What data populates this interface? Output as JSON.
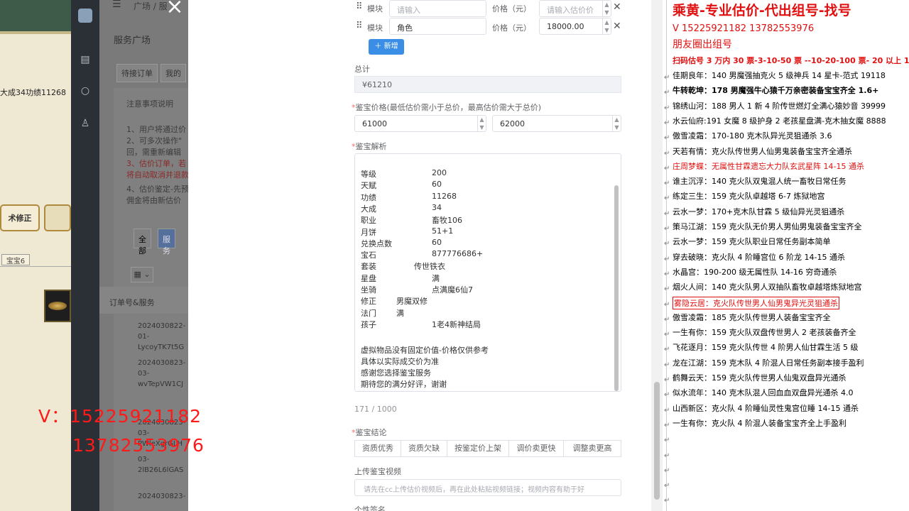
{
  "game": {
    "stat_text": "大成34功绩11268",
    "button_label": "术修正",
    "tab_label": "宝宝6"
  },
  "app": {
    "breadcrumb": "广场 / 服",
    "page_title": "服务广场",
    "tabs": [
      "待接订单",
      "我的"
    ],
    "notes_title": "注意事项说明",
    "notes": [
      {
        "text": "1、用户将通过价",
        "red": false
      },
      {
        "text": "2、可多次操作\"",
        "red": false
      },
      {
        "text": "回，需重新编辑",
        "red": false
      },
      {
        "text": "3、估价订单，若",
        "red": true
      },
      {
        "text": "将自动取消并退款",
        "red": true
      },
      {
        "text": "4、估价鉴定-先预",
        "red": false
      },
      {
        "text": "佣金将由新估价",
        "red": false
      }
    ],
    "filter": [
      "全部",
      "服务"
    ],
    "grid_label": "▦ ⌄",
    "table_header": "订单号&服务",
    "orders": [
      {
        "line1": "2024030822-",
        "line2": "01-",
        "line3": "LycoyTK7t5G"
      },
      {
        "line1": "2024030823-",
        "line2": "03-",
        "line3": "wvTepVW1CJ"
      },
      {
        "line1": "2024030823-",
        "line2": "03-",
        "line3": "PWleXgrGLH"
      },
      {
        "line1": "03-",
        "line2": "2lB26L6lGAS",
        "line3": ""
      },
      {
        "line1": "2024030823-",
        "line2": "",
        "line3": ""
      }
    ]
  },
  "drawer": {
    "rows": [
      {
        "module_label": "模块",
        "module_value": "请输入",
        "price_label": "价格（元）",
        "price_value": "请输入估价价"
      },
      {
        "module_label": "模块",
        "module_value": "角色",
        "price_label": "价格（元）",
        "price_value": "18000.00"
      }
    ],
    "add_label": "新增",
    "total_label": "总计",
    "total_value": "¥61210",
    "appraisal_label": "鉴宝价格(最低估价需小于总价，最高估价需大于总价)",
    "min_price": "61000",
    "max_price": "62000",
    "analysis_label": "鉴宝解析",
    "analysis_rows": [
      {
        "key": "等级",
        "value": "200",
        "offset": "wide"
      },
      {
        "key": "天赋",
        "value": "60",
        "offset": "wide"
      },
      {
        "key": "功绩",
        "value": "11268",
        "offset": "wide"
      },
      {
        "key": "大成",
        "value": "34",
        "offset": "wide"
      },
      {
        "key": "职业",
        "value": "畜牧106",
        "offset": "wide"
      },
      {
        "key": "月饼",
        "value": "51+1",
        "offset": "wide"
      },
      {
        "key": "兑换点数",
        "value": "60",
        "offset": "wide"
      },
      {
        "key": "宝石",
        "value": "877776686+",
        "offset": "wide"
      },
      {
        "key": "套装",
        "value": "传世铁衣",
        "offset": "mid"
      },
      {
        "key": "星盘",
        "value": "满",
        "offset": "wide"
      },
      {
        "key": "坐骑",
        "value": "点满魔6仙7",
        "offset": "wide"
      },
      {
        "key": "修正",
        "value": "男魔双修",
        "offset": "narrow"
      },
      {
        "key": "法门",
        "value": "满",
        "offset": "narrow"
      },
      {
        "key": "孩子",
        "value": "1老4新神结局",
        "offset": "wide"
      }
    ],
    "analysis_footer": [
      "虚拟物品没有固定价值-价格仅供参考",
      "具体以实际成交价为准",
      "感谢您选择鉴宝服务",
      "期待您的满分好评，谢谢"
    ],
    "char_counter": "171 / 1000",
    "conclusion_label": "鉴宝结论",
    "conclusion_options": [
      "资质优秀",
      "资质欠缺",
      "按鉴定价上架",
      "调价卖更快",
      "调整卖更高"
    ],
    "video_label": "上传鉴宝视频",
    "video_placeholder": "请先在cc上传估价视频后，再在此处粘贴视频链接；视频内容有助于好",
    "next_label": "个性签名"
  },
  "ad": {
    "headline": "乘黄-专业估价-代出组号-找号",
    "phones": "V    15225921182    13782553976",
    "subline": "朋友圈出组号",
    "price_tiers": "扫码估号 3 万内 30 票-3-10-50 票 --10-20-100 票- 20 以上 150",
    "entries": [
      {
        "text": "佳期良年：140 男魔强抽克火 5 级神兵 14 星卡-范式 19118",
        "style": ""
      },
      {
        "text": "牛转乾坤：178 男魔强牛心猿千万亲密装备宝宝齐全 1.6+",
        "style": "bold"
      },
      {
        "text": "锦绣山河：188 男人 1 新 4 阶传世燃灯全满心猿妙音 39999",
        "style": ""
      },
      {
        "text": "水云仙府:191 女魔 8 级护身 2 老孩星盘满-克木抽女魔 8888",
        "style": ""
      },
      {
        "text": "傲雪凌霜：170-180 克木队异光灵狙通杀 3.6",
        "style": ""
      },
      {
        "text": "天若有情：克火队传世男人仙男鬼装备宝宝齐全通杀",
        "style": ""
      },
      {
        "text": "庄周梦蝶：无属性甘霖遗忘大力队玄武星阵 14-15 通杀",
        "style": "red"
      },
      {
        "text": "谁主沉浮：140 克火队双鬼混人统一畜牧日常任务",
        "style": ""
      },
      {
        "text": "练定三生：159 克火队卓越塔 6-7 炼狱地宫",
        "style": ""
      },
      {
        "text": "云水一梦：170+克木队甘霖 5 级仙异光灵狙通杀",
        "style": ""
      },
      {
        "text": "策马江湖：159 克火队无价男人男仙男鬼装备宝宝齐全",
        "style": ""
      },
      {
        "text": "云水一梦：159 克火队职业日常任务副本简单",
        "style": ""
      },
      {
        "text": "穿去破晓：克火队 4 阶睡宫位 6 阶龙 14-15 通杀",
        "style": ""
      },
      {
        "text": "水晶宫：190-200 级无属性队 14-16 穷奇通杀",
        "style": ""
      },
      {
        "text": "烟火人间：140 克火队男人双抽队畜牧卓越塔炼狱地宫",
        "style": ""
      },
      {
        "text": "雾隐云居：克火队传世男人仙男鬼异光灵狙通杀",
        "style": "redbox"
      },
      {
        "text": "傲雪凌霜：185 克火队传世男人装备宝宝齐全",
        "style": ""
      },
      {
        "text": "一生有你：159 克火队双盘传世男人 2 老孩装备齐全",
        "style": ""
      },
      {
        "text": "飞花逐月：159 克火队传世 4 阶男人仙甘霖生活 5 级",
        "style": ""
      },
      {
        "text": "龙在江湖：159 克木队 4 阶混人日常任务副本接手盈利",
        "style": ""
      },
      {
        "text": "鹤舞云天：159 克火队传世男人仙鬼双盘异光通杀",
        "style": ""
      },
      {
        "text": "似水流年：140 克木队混人回血血双盘异光通杀 4.0",
        "style": ""
      },
      {
        "text": "山西新区：克火队 4 阶睡仙灵性鬼宫位睡 14-15 通杀",
        "style": ""
      },
      {
        "text": "一生有你：克火队 4 阶混人装备宝宝齐全上手盈利",
        "style": ""
      }
    ]
  },
  "watermark": {
    "line1": "V：15225921182",
    "line2": "13782553976"
  },
  "colors": {
    "accent": "#3a8ee6",
    "ad_red": "#e01010",
    "watermark_red": "#ff1a1a"
  }
}
